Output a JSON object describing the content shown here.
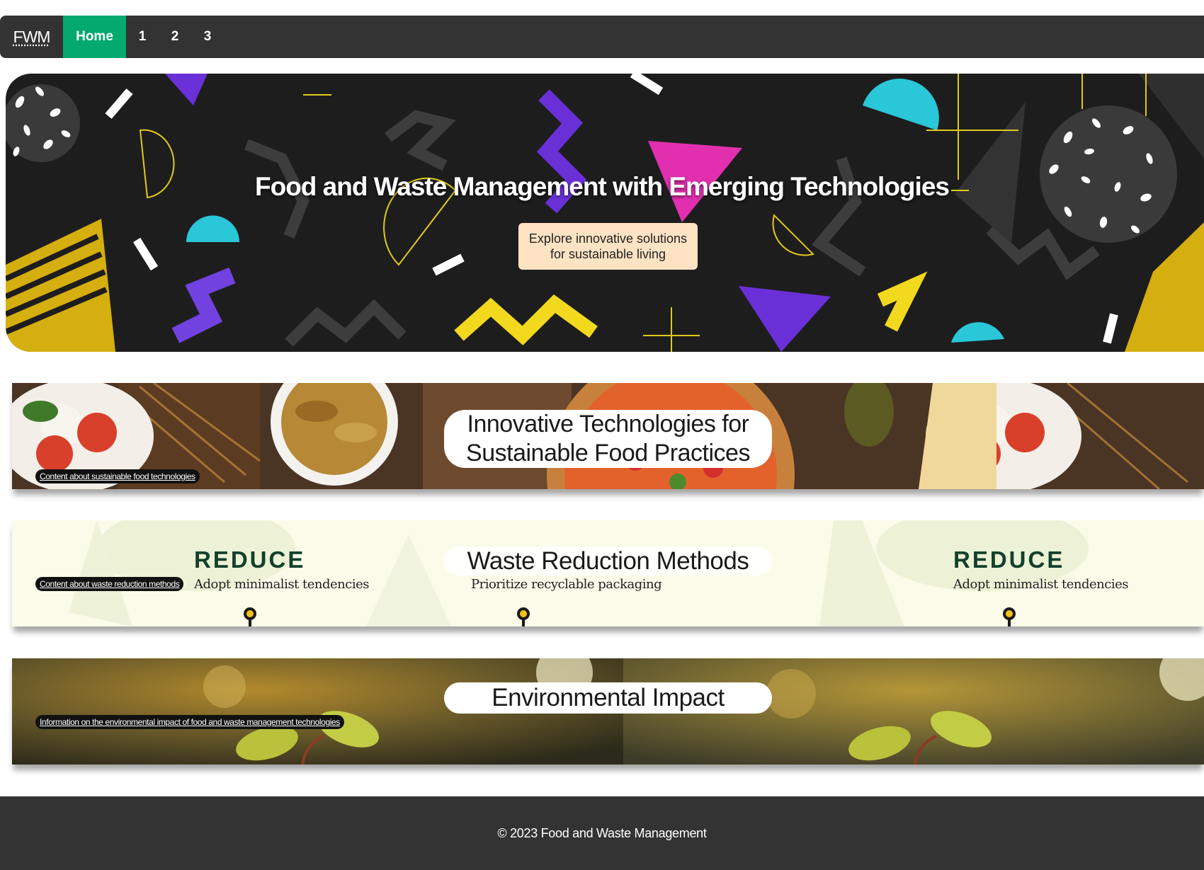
{
  "nav": {
    "brand": "FWM",
    "home": "Home",
    "links": [
      "1",
      "2",
      "3"
    ]
  },
  "hero": {
    "title": "Food and Waste Management with Emerging Technologies",
    "subtitle": "Explore innovative solutions for sustainable living"
  },
  "sections": {
    "tech": {
      "heading": "Innovative Technologies for Sustainable Food Practices",
      "caption": "Content about sustainable food technologies"
    },
    "waste": {
      "heading": "Waste Reduction Methods",
      "caption": "Content about waste reduction methods",
      "left_word": "REDUCE",
      "left_text": "Adopt minimalist tendencies",
      "middle_text": "Prioritize recyclable packaging",
      "right_word": "REDUCE",
      "right_text": "Adopt minimalist tendencies"
    },
    "impact": {
      "heading": "Environmental Impact",
      "caption": "Information on the environmental impact of food and waste management technologies"
    }
  },
  "footer": {
    "text": "© 2023 Food and Waste Management"
  },
  "colors": {
    "nav_bg": "#333333",
    "home_active": "#04aa6d",
    "hero_bg": "#1e1d1e",
    "subtitle_bg": "#fde3c3",
    "waste_bg": "#fbfbe9",
    "reduce_green": "#12402b"
  }
}
